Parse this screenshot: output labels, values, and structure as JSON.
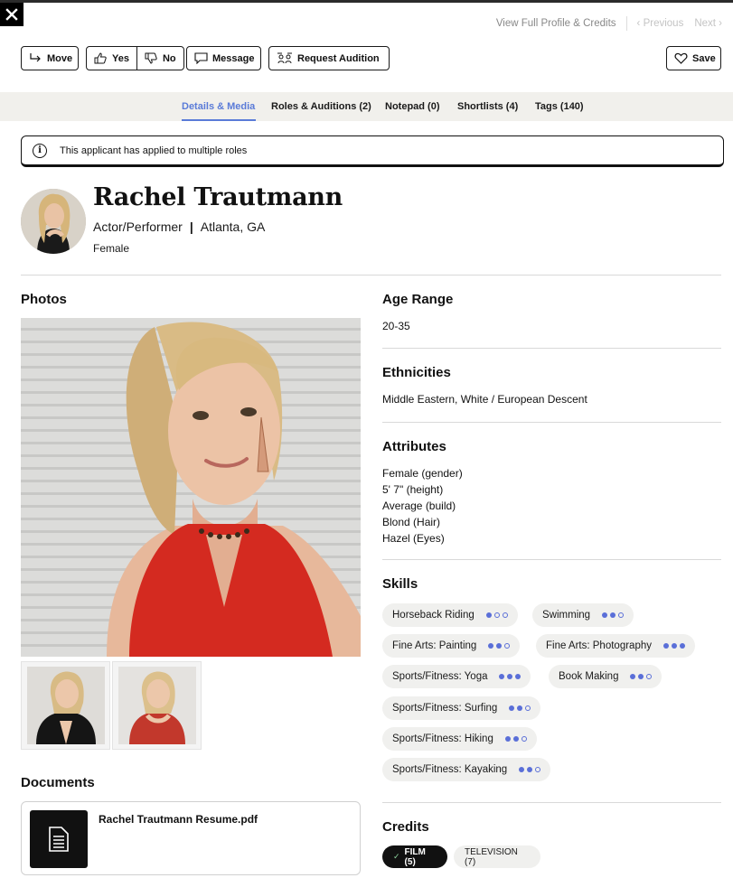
{
  "topnav": {
    "view_full_profile": "View Full Profile & Credits",
    "previous": "‹ Previous",
    "next": "Next ›"
  },
  "toolbar": {
    "move_label": "Move",
    "yes_label": "Yes",
    "no_label": "No",
    "message_label": "Message",
    "request_audition_label": "Request Audition",
    "save_label": "Save"
  },
  "tabs": [
    {
      "label": "Details & Media",
      "active": true
    },
    {
      "label": "Roles & Auditions (2)",
      "active": false
    },
    {
      "label": "Notepad (0)",
      "active": false
    },
    {
      "label": "Shortlists (4)",
      "active": false
    },
    {
      "label": "Tags (140)",
      "active": false
    }
  ],
  "alert": {
    "text": "This applicant has applied to multiple roles"
  },
  "profile": {
    "name": "Rachel Trautmann",
    "role": "Actor/Performer",
    "location": "Atlanta, GA",
    "gender": "Female"
  },
  "photos": {
    "title": "Photos"
  },
  "documents": {
    "title": "Documents",
    "files": [
      {
        "name": "Rachel Trautmann Resume.pdf"
      }
    ]
  },
  "age_range": {
    "title": "Age Range",
    "value": "20-35"
  },
  "ethnicities": {
    "title": "Ethnicities",
    "value": "Middle Eastern, White / European Descent"
  },
  "attributes": {
    "title": "Attributes",
    "items": [
      "Female (gender)",
      "5' 7\" (height)",
      "Average (build)",
      "Blond (Hair)",
      "Hazel (Eyes)"
    ]
  },
  "skills": {
    "title": "Skills",
    "items": [
      {
        "label": "Horseback Riding",
        "level": 1
      },
      {
        "label": "Swimming",
        "level": 2
      },
      {
        "label": "Fine Arts: Painting",
        "level": 2
      },
      {
        "label": "Fine Arts: Photography",
        "level": 3
      },
      {
        "label": "Sports/Fitness: Yoga",
        "level": 3
      },
      {
        "label": "Book Making",
        "level": 2
      },
      {
        "label": "Sports/Fitness: Surfing",
        "level": 2
      },
      {
        "label": "Sports/Fitness: Hiking",
        "level": 2
      },
      {
        "label": "Sports/Fitness: Kayaking",
        "level": 2
      }
    ],
    "max_level": 3
  },
  "credits": {
    "title": "Credits",
    "tabs": [
      {
        "label": "FILM (5)",
        "active": true
      },
      {
        "label": "TELEVISION (7)",
        "active": false
      }
    ]
  },
  "colors": {
    "accent": "#5a7bd8",
    "skill_dot": "#5a6fd8",
    "dress_red": "#d42a20",
    "tab_bar_bg": "#f1f0ec"
  }
}
